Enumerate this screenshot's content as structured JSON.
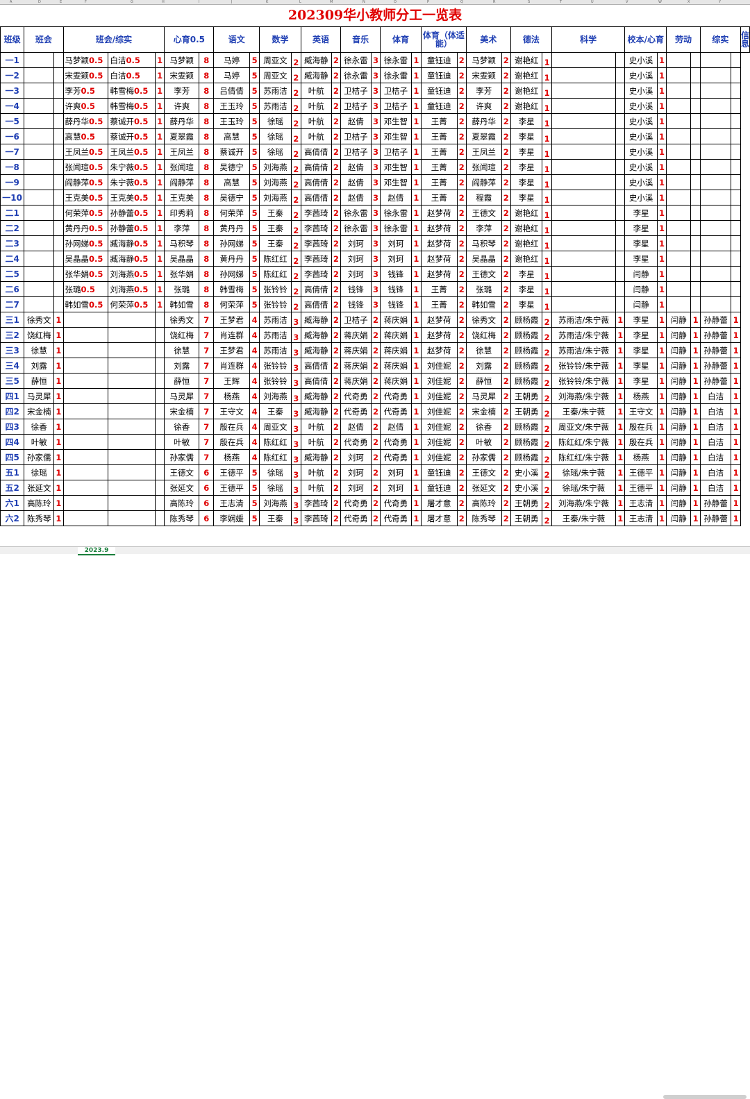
{
  "title": "202309华小教师分工一览表",
  "sheet_tab": "2023.9",
  "col_letters": [
    "A",
    "D",
    "E",
    "F",
    "G",
    "H",
    "I",
    "J",
    "K",
    "L",
    "M",
    "N",
    "O",
    "P",
    "Q",
    "R",
    "S",
    "T",
    "U",
    "V",
    "W",
    "X",
    "Y",
    "Z",
    "AA",
    "AB",
    "AC",
    "AD",
    "AE",
    "AF",
    "AG"
  ],
  "headers": [
    "班级",
    "班会",
    "班会/综实",
    "心育0.5",
    "语文",
    "数学",
    "英语",
    "音乐",
    "体育",
    "体育（体适能）",
    "美术",
    "德法",
    "科学",
    "校本/心育",
    "劳动",
    "综实",
    "信息"
  ],
  "colors": {
    "title": "#e00000",
    "header": "#1f3fb3",
    "number": "#e00000"
  },
  "rows": [
    [
      "一1",
      "",
      "",
      "马梦颖",
      "0.5",
      "白洁",
      "0.5",
      "1",
      "马梦颖",
      "8",
      "马婷",
      "5",
      "周亚文",
      "2",
      "臧海静",
      "2",
      "徐永雷",
      "3",
      "徐永雷",
      "1",
      "童钰迪",
      "2",
      "马梦颖",
      "2",
      "谢艳红",
      "1",
      "",
      "",
      "史小溪",
      "1",
      "",
      "",
      "",
      ""
    ],
    [
      "一2",
      "",
      "",
      "宋雯颖",
      "0.5",
      "白洁",
      "0.5",
      "1",
      "宋雯颖",
      "8",
      "马婷",
      "5",
      "周亚文",
      "2",
      "臧海静",
      "2",
      "徐永雷",
      "3",
      "徐永雷",
      "1",
      "童钰迪",
      "2",
      "宋雯颖",
      "2",
      "谢艳红",
      "1",
      "",
      "",
      "史小溪",
      "1",
      "",
      "",
      "",
      ""
    ],
    [
      "一3",
      "",
      "",
      "李芳",
      "0.5",
      "韩雪梅",
      "0.5",
      "1",
      "李芳",
      "8",
      "吕倩倩",
      "5",
      "苏雨洁",
      "2",
      "叶航",
      "2",
      "卫桔子",
      "3",
      "卫桔子",
      "1",
      "童钰迪",
      "2",
      "李芳",
      "2",
      "谢艳红",
      "1",
      "",
      "",
      "史小溪",
      "1",
      "",
      "",
      "",
      ""
    ],
    [
      "一4",
      "",
      "",
      "许爽",
      "0.5",
      "韩雪梅",
      "0.5",
      "1",
      "许爽",
      "8",
      "王玉玲",
      "5",
      "苏雨洁",
      "2",
      "叶航",
      "2",
      "卫桔子",
      "3",
      "卫桔子",
      "1",
      "童钰迪",
      "2",
      "许爽",
      "2",
      "谢艳红",
      "1",
      "",
      "",
      "史小溪",
      "1",
      "",
      "",
      "",
      ""
    ],
    [
      "一5",
      "",
      "",
      "薛丹华",
      "0.5",
      "蔡诚开",
      "0.5",
      "1",
      "薛丹华",
      "8",
      "王玉玲",
      "5",
      "徐瑶",
      "2",
      "叶航",
      "2",
      "赵倩",
      "3",
      "邓生智",
      "1",
      "王菁",
      "2",
      "薛丹华",
      "2",
      "李星",
      "1",
      "",
      "",
      "史小溪",
      "1",
      "",
      "",
      "",
      ""
    ],
    [
      "一6",
      "",
      "",
      "高慧",
      "0.5",
      "蔡诚开",
      "0.5",
      "1",
      "夏翠霞",
      "8",
      "高慧",
      "5",
      "徐瑶",
      "2",
      "叶航",
      "2",
      "卫桔子",
      "3",
      "邓生智",
      "1",
      "王菁",
      "2",
      "夏翠霞",
      "2",
      "李星",
      "1",
      "",
      "",
      "史小溪",
      "1",
      "",
      "",
      "",
      ""
    ],
    [
      "一7",
      "",
      "",
      "王凤兰",
      "0.5",
      "王凤兰",
      "0.5",
      "1",
      "王凤兰",
      "8",
      "蔡诚开",
      "5",
      "徐瑶",
      "2",
      "高倩倩",
      "2",
      "卫桔子",
      "3",
      "卫桔子",
      "1",
      "王菁",
      "2",
      "王凤兰",
      "2",
      "李星",
      "1",
      "",
      "",
      "史小溪",
      "1",
      "",
      "",
      "",
      ""
    ],
    [
      "一8",
      "",
      "",
      "张闻瑄",
      "0.5",
      "朱宁薇",
      "0.5",
      "1",
      "张闻瑄",
      "8",
      "吴德宁",
      "5",
      "刘海燕",
      "2",
      "高倩倩",
      "2",
      "赵倩",
      "3",
      "邓生智",
      "1",
      "王菁",
      "2",
      "张闻瑄",
      "2",
      "李星",
      "1",
      "",
      "",
      "史小溪",
      "1",
      "",
      "",
      "",
      ""
    ],
    [
      "一9",
      "",
      "",
      "阎静萍",
      "0.5",
      "朱宁薇",
      "0.5",
      "1",
      "阎静萍",
      "8",
      "高慧",
      "5",
      "刘海燕",
      "2",
      "高倩倩",
      "2",
      "赵倩",
      "3",
      "邓生智",
      "1",
      "王菁",
      "2",
      "阎静萍",
      "2",
      "李星",
      "1",
      "",
      "",
      "史小溪",
      "1",
      "",
      "",
      "",
      ""
    ],
    [
      "一10",
      "",
      "",
      "王克美",
      "0.5",
      "王克美",
      "0.5",
      "1",
      "王克美",
      "8",
      "吴德宁",
      "5",
      "刘海燕",
      "2",
      "高倩倩",
      "2",
      "赵倩",
      "3",
      "赵倩",
      "1",
      "王菁",
      "2",
      "程霞",
      "2",
      "李星",
      "1",
      "",
      "",
      "史小溪",
      "1",
      "",
      "",
      "",
      ""
    ],
    [
      "二1",
      "",
      "",
      "何荣萍",
      "0.5",
      "孙静蕾",
      "0.5",
      "1",
      "印秀莉",
      "8",
      "何荣萍",
      "5",
      "王秦",
      "2",
      "李茜琦",
      "2",
      "徐永雷",
      "3",
      "徐永雷",
      "1",
      "赵梦荷",
      "2",
      "王德文",
      "2",
      "谢艳红",
      "1",
      "",
      "",
      "李星",
      "1",
      "",
      "",
      "",
      ""
    ],
    [
      "二2",
      "",
      "",
      "黄丹丹",
      "0.5",
      "孙静蕾",
      "0.5",
      "1",
      "李萍",
      "8",
      "黄丹丹",
      "5",
      "王秦",
      "2",
      "李茜琦",
      "2",
      "徐永雷",
      "3",
      "徐永雷",
      "1",
      "赵梦荷",
      "2",
      "李萍",
      "2",
      "谢艳红",
      "1",
      "",
      "",
      "李星",
      "1",
      "",
      "",
      "",
      ""
    ],
    [
      "二3",
      "",
      "",
      "孙网娣",
      "0.5",
      "臧海静",
      "0.5",
      "1",
      "马积琴",
      "8",
      "孙网娣",
      "5",
      "王秦",
      "2",
      "李茜琦",
      "2",
      "刘珂",
      "3",
      "刘珂",
      "1",
      "赵梦荷",
      "2",
      "马积琴",
      "2",
      "谢艳红",
      "1",
      "",
      "",
      "李星",
      "1",
      "",
      "",
      "",
      ""
    ],
    [
      "二4",
      "",
      "",
      "吴晶晶",
      "0.5",
      "臧海静",
      "0.5",
      "1",
      "吴晶晶",
      "8",
      "黄丹丹",
      "5",
      "陈红红",
      "2",
      "李茜琦",
      "2",
      "刘珂",
      "3",
      "刘珂",
      "1",
      "赵梦荷",
      "2",
      "吴晶晶",
      "2",
      "谢艳红",
      "1",
      "",
      "",
      "李星",
      "1",
      "",
      "",
      "",
      ""
    ],
    [
      "二5",
      "",
      "",
      "张华娟",
      "0.5",
      "刘海燕",
      "0.5",
      "1",
      "张华娟",
      "8",
      "孙网娣",
      "5",
      "陈红红",
      "2",
      "李茜琦",
      "2",
      "刘珂",
      "3",
      "钱锋",
      "1",
      "赵梦荷",
      "2",
      "王德文",
      "2",
      "李星",
      "1",
      "",
      "",
      "闫静",
      "1",
      "",
      "",
      "",
      ""
    ],
    [
      "二6",
      "",
      "",
      "张璐",
      "0.5",
      "刘海燕",
      "0.5",
      "1",
      "张璐",
      "8",
      "韩雪梅",
      "5",
      "张铃铃",
      "2",
      "高倩倩",
      "2",
      "钱锋",
      "3",
      "钱锋",
      "1",
      "王菁",
      "2",
      "张璐",
      "2",
      "李星",
      "1",
      "",
      "",
      "闫静",
      "1",
      "",
      "",
      "",
      ""
    ],
    [
      "二7",
      "",
      "",
      "韩如雪",
      "0.5",
      "何荣萍",
      "0.5",
      "1",
      "韩如雪",
      "8",
      "何荣萍",
      "5",
      "张铃铃",
      "2",
      "高倩倩",
      "2",
      "钱锋",
      "3",
      "钱锋",
      "1",
      "王菁",
      "2",
      "韩如雪",
      "2",
      "李星",
      "1",
      "",
      "",
      "闫静",
      "1",
      "",
      "",
      "",
      ""
    ],
    [
      "三1",
      "徐秀文",
      "1",
      "",
      "",
      "",
      "",
      "",
      "徐秀文",
      "7",
      "王梦君",
      "4",
      "苏雨洁",
      "3",
      "臧海静",
      "2",
      "卫桔子",
      "2",
      "蒋庆娟",
      "1",
      "赵梦荷",
      "2",
      "徐秀文",
      "2",
      "顾杨霞",
      "2",
      "苏雨洁/朱宁薇",
      "1",
      "李星",
      "1",
      "闫静",
      "1",
      "孙静蕾",
      "1"
    ],
    [
      "三2",
      "饶红梅",
      "1",
      "",
      "",
      "",
      "",
      "",
      "饶红梅",
      "7",
      "肖连群",
      "4",
      "苏雨洁",
      "3",
      "臧海静",
      "2",
      "蒋庆娟",
      "2",
      "蒋庆娟",
      "1",
      "赵梦荷",
      "2",
      "饶红梅",
      "2",
      "顾杨霞",
      "2",
      "苏雨洁/朱宁薇",
      "1",
      "李星",
      "1",
      "闫静",
      "1",
      "孙静蕾",
      "1"
    ],
    [
      "三3",
      "徐慧",
      "1",
      "",
      "",
      "",
      "",
      "",
      "徐慧",
      "7",
      "王梦君",
      "4",
      "苏雨洁",
      "3",
      "臧海静",
      "2",
      "蒋庆娟",
      "2",
      "蒋庆娟",
      "1",
      "赵梦荷",
      "2",
      "徐慧",
      "2",
      "顾杨霞",
      "2",
      "苏雨洁/朱宁薇",
      "1",
      "李星",
      "1",
      "闫静",
      "1",
      "孙静蕾",
      "1"
    ],
    [
      "三4",
      "刘露",
      "1",
      "",
      "",
      "",
      "",
      "",
      "刘露",
      "7",
      "肖连群",
      "4",
      "张铃铃",
      "3",
      "高倩倩",
      "2",
      "蒋庆娟",
      "2",
      "蒋庆娟",
      "1",
      "刘佳妮",
      "2",
      "刘露",
      "2",
      "顾杨霞",
      "2",
      "张铃铃/朱宁薇",
      "1",
      "李星",
      "1",
      "闫静",
      "1",
      "孙静蕾",
      "1"
    ],
    [
      "三5",
      "薛恒",
      "1",
      "",
      "",
      "",
      "",
      "",
      "薛恒",
      "7",
      "王辉",
      "4",
      "张铃铃",
      "3",
      "高倩倩",
      "2",
      "蒋庆娟",
      "2",
      "蒋庆娟",
      "1",
      "刘佳妮",
      "2",
      "薛恒",
      "2",
      "顾杨霞",
      "2",
      "张铃铃/朱宁薇",
      "1",
      "李星",
      "1",
      "闫静",
      "1",
      "孙静蕾",
      "1"
    ],
    [
      "四1",
      "马灵犀",
      "1",
      "",
      "",
      "",
      "",
      "",
      "马灵犀",
      "7",
      "杨燕",
      "4",
      "刘海燕",
      "3",
      "臧海静",
      "2",
      "代奇勇",
      "2",
      "代奇勇",
      "1",
      "刘佳妮",
      "2",
      "马灵犀",
      "2",
      "王朝勇",
      "2",
      "刘海燕/朱宁薇",
      "1",
      "杨燕",
      "1",
      "闫静",
      "1",
      "白洁",
      "1"
    ],
    [
      "四2",
      "宋金楠",
      "1",
      "",
      "",
      "",
      "",
      "",
      "宋金楠",
      "7",
      "王守文",
      "4",
      "王秦",
      "3",
      "臧海静",
      "2",
      "代奇勇",
      "2",
      "代奇勇",
      "1",
      "刘佳妮",
      "2",
      "宋金楠",
      "2",
      "王朝勇",
      "2",
      "王秦/朱宁薇",
      "1",
      "王守文",
      "1",
      "闫静",
      "1",
      "白洁",
      "1"
    ],
    [
      "四3",
      "徐香",
      "1",
      "",
      "",
      "",
      "",
      "",
      "徐香",
      "7",
      "殷在兵",
      "4",
      "周亚文",
      "3",
      "叶航",
      "2",
      "赵倩",
      "2",
      "赵倩",
      "1",
      "刘佳妮",
      "2",
      "徐香",
      "2",
      "顾杨霞",
      "2",
      "周亚文/朱宁薇",
      "1",
      "殷在兵",
      "1",
      "闫静",
      "1",
      "白洁",
      "1"
    ],
    [
      "四4",
      "叶敏",
      "1",
      "",
      "",
      "",
      "",
      "",
      "叶敏",
      "7",
      "殷在兵",
      "4",
      "陈红红",
      "3",
      "叶航",
      "2",
      "代奇勇",
      "2",
      "代奇勇",
      "1",
      "刘佳妮",
      "2",
      "叶敏",
      "2",
      "顾杨霞",
      "2",
      "陈红红/朱宁薇",
      "1",
      "殷在兵",
      "1",
      "闫静",
      "1",
      "白洁",
      "1"
    ],
    [
      "四5",
      "孙家儒",
      "1",
      "",
      "",
      "",
      "",
      "",
      "孙家儒",
      "7",
      "杨燕",
      "4",
      "陈红红",
      "3",
      "臧海静",
      "2",
      "刘珂",
      "2",
      "代奇勇",
      "1",
      "刘佳妮",
      "2",
      "孙家儒",
      "2",
      "顾杨霞",
      "2",
      "陈红红/朱宁薇",
      "1",
      "杨燕",
      "1",
      "闫静",
      "1",
      "白洁",
      "1"
    ],
    [
      "五1",
      "徐瑶",
      "1",
      "",
      "",
      "",
      "",
      "",
      "王德文",
      "6",
      "王德平",
      "5",
      "徐瑶",
      "3",
      "叶航",
      "2",
      "刘珂",
      "2",
      "刘珂",
      "1",
      "童钰迪",
      "2",
      "王德文",
      "2",
      "史小溪",
      "2",
      "徐瑶/朱宁薇",
      "1",
      "王德平",
      "1",
      "闫静",
      "1",
      "白洁",
      "1"
    ],
    [
      "五2",
      "张延文",
      "1",
      "",
      "",
      "",
      "",
      "",
      "张延文",
      "6",
      "王德平",
      "5",
      "徐瑶",
      "3",
      "叶航",
      "2",
      "刘珂",
      "2",
      "刘珂",
      "1",
      "童钰迪",
      "2",
      "张延文",
      "2",
      "史小溪",
      "2",
      "徐瑶/朱宁薇",
      "1",
      "王德平",
      "1",
      "闫静",
      "1",
      "白洁",
      "1"
    ],
    [
      "六1",
      "高陈玲",
      "1",
      "",
      "",
      "",
      "",
      "",
      "高陈玲",
      "6",
      "王志清",
      "5",
      "刘海燕",
      "3",
      "李茜琦",
      "2",
      "代奇勇",
      "2",
      "代奇勇",
      "1",
      "屠才意",
      "2",
      "高陈玲",
      "2",
      "王朝勇",
      "2",
      "刘海燕/朱宁薇",
      "1",
      "王志清",
      "1",
      "闫静",
      "1",
      "孙静蕾",
      "1"
    ],
    [
      "六2",
      "陈秀琴",
      "1",
      "",
      "",
      "",
      "",
      "",
      "陈秀琴",
      "6",
      "李娴媛",
      "5",
      "王秦",
      "3",
      "李茜琦",
      "2",
      "代奇勇",
      "2",
      "代奇勇",
      "1",
      "屠才意",
      "2",
      "陈秀琴",
      "2",
      "王朝勇",
      "2",
      "王秦/朱宁薇",
      "1",
      "王志清",
      "1",
      "闫静",
      "1",
      "孙静蕾",
      "1"
    ]
  ]
}
